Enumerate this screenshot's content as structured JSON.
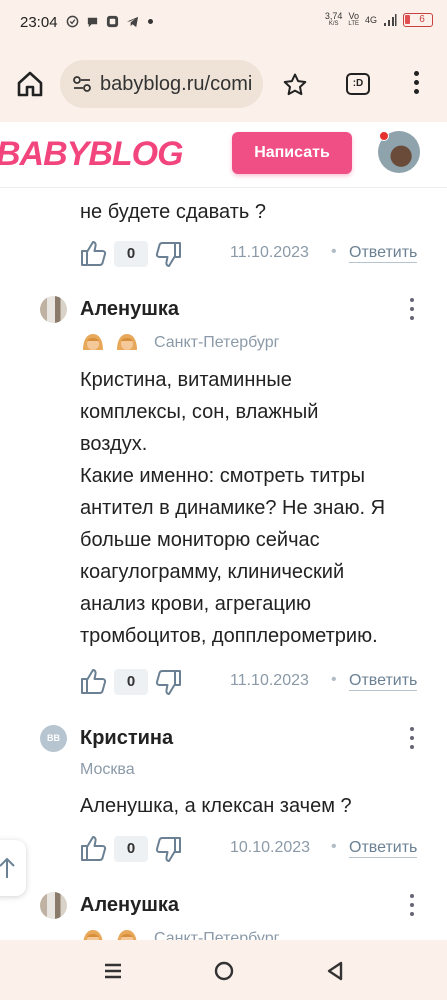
{
  "status_bar": {
    "time": "23:04",
    "net_speed": "3,74",
    "net_speed_unit": "K/S",
    "volte": "Vo",
    "volte2": "LTE",
    "network": "4G",
    "battery": "6",
    "icons": [
      "check-circle-icon",
      "chat-bubble-icon",
      "app-icon",
      "telegram-icon",
      "dot-icon",
      "signal-icon"
    ]
  },
  "browser": {
    "url": "babyblog.ru/comi",
    "tab_count": ":D",
    "icons": [
      "home-icon",
      "site-settings-icon",
      "star-icon",
      "tabs-icon",
      "menu-icon"
    ]
  },
  "site": {
    "logo": "BABYBLOG",
    "write_button": "Написать",
    "accent_color": "#ef4f84"
  },
  "trailing_comment": {
    "text": "не будете сдавать ?",
    "likes": "0",
    "date": "11.10.2023",
    "reply": "Ответить"
  },
  "comments": [
    {
      "author": "Аленушка",
      "city": "Санкт-Петербург",
      "badges": 2,
      "lines": [
        "Кристина, витаминные",
        "комплексы, сон, влажный",
        "воздух.",
        "Какие именно: смотреть титры",
        "антител в динамике? Не знаю. Я",
        "больше мониторю сейчас",
        "коагулограмму, клинический",
        "анализ крови, агрегацию",
        "тромбоцитов, допплерометрию."
      ],
      "likes": "0",
      "date": "11.10.2023",
      "reply": "Ответить"
    },
    {
      "author": "Кристина",
      "avatar_initials": "BB",
      "city": "Москва",
      "lines": [
        "Аленушка, а клексан зачем ?"
      ],
      "likes": "0",
      "date": "10.10.2023",
      "reply": "Ответить"
    },
    {
      "author": "Аленушка",
      "city": "Санкт-Петербург",
      "badges": 2
    }
  ],
  "separator": "•"
}
